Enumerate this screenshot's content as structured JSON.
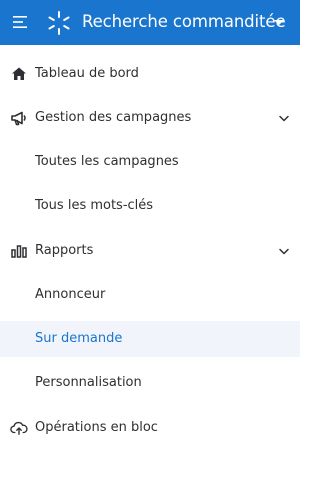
{
  "header": {
    "title": "Recherche commanditée",
    "menu_icon": "hamburger-menu-icon",
    "logo_icon": "spark-logo-icon",
    "dropdown_icon": "caret-down-icon",
    "background": "#1a75cf"
  },
  "nav": {
    "items": [
      {
        "label": "Tableau de bord",
        "icon": "home-icon"
      },
      {
        "label": "Gestion des campagnes",
        "icon": "megaphone-icon",
        "expanded": true
      },
      {
        "label": "Toutes les campagnes"
      },
      {
        "label": "Tous les mots-clés"
      },
      {
        "label": "Rapports",
        "icon": "bar-chart-icon",
        "expanded": true
      },
      {
        "label": "Annonceur"
      },
      {
        "label": "Sur demande",
        "active": true
      },
      {
        "label": "Personnalisation"
      },
      {
        "label": "Opérations en bloc",
        "icon": "cloud-upload-icon"
      }
    ]
  },
  "colors": {
    "accent": "#1a75cf",
    "active_background": "#f1f5fb",
    "text": "#2e2f32"
  }
}
